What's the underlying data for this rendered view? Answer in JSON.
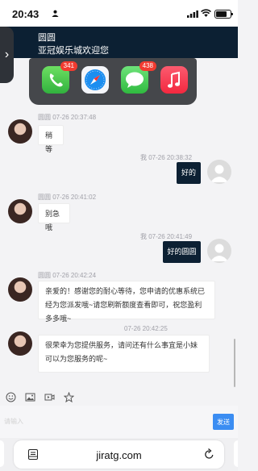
{
  "status_bar": {
    "time": "20:43"
  },
  "header": {
    "name": "圆圆",
    "subtitle": "亚冠娱乐城欢迎您"
  },
  "dock": {
    "apps": [
      {
        "name": "phone",
        "badge": "341"
      },
      {
        "name": "safari",
        "badge": ""
      },
      {
        "name": "messages",
        "badge": "438"
      },
      {
        "name": "music",
        "badge": ""
      }
    ]
  },
  "messages": [
    {
      "side": "left",
      "meta": "圆圆 07-26 20:37:48",
      "text": "稍等"
    },
    {
      "side": "right",
      "meta": "我 07-26 20:38:32",
      "text": "好的"
    },
    {
      "side": "left",
      "meta": "圆圆 07-26 20:41:02",
      "text": "别急哦"
    },
    {
      "side": "right",
      "meta": "我 07-26 20:41:49",
      "text": "好的圆圆"
    },
    {
      "side": "left",
      "meta": "圆圆 07-26 20:42:24",
      "text": "亲爱的！感谢您的耐心等待，您申请的优惠系统已经为您派发哦~请您刷新额度查看即可，祝您盈利多多哦~"
    },
    {
      "side": "left",
      "meta": "07-26 20:42:25",
      "text": "很荣幸为您提供服务，请问还有什么事宜是小妹可以为您服务的呢~"
    }
  ],
  "composer": {
    "placeholder": "请输入",
    "send_label": "发送"
  },
  "browser": {
    "url": "jiratg.com"
  },
  "colors": {
    "header_bg": "#0c2033",
    "send_bg": "#3b8df2"
  }
}
